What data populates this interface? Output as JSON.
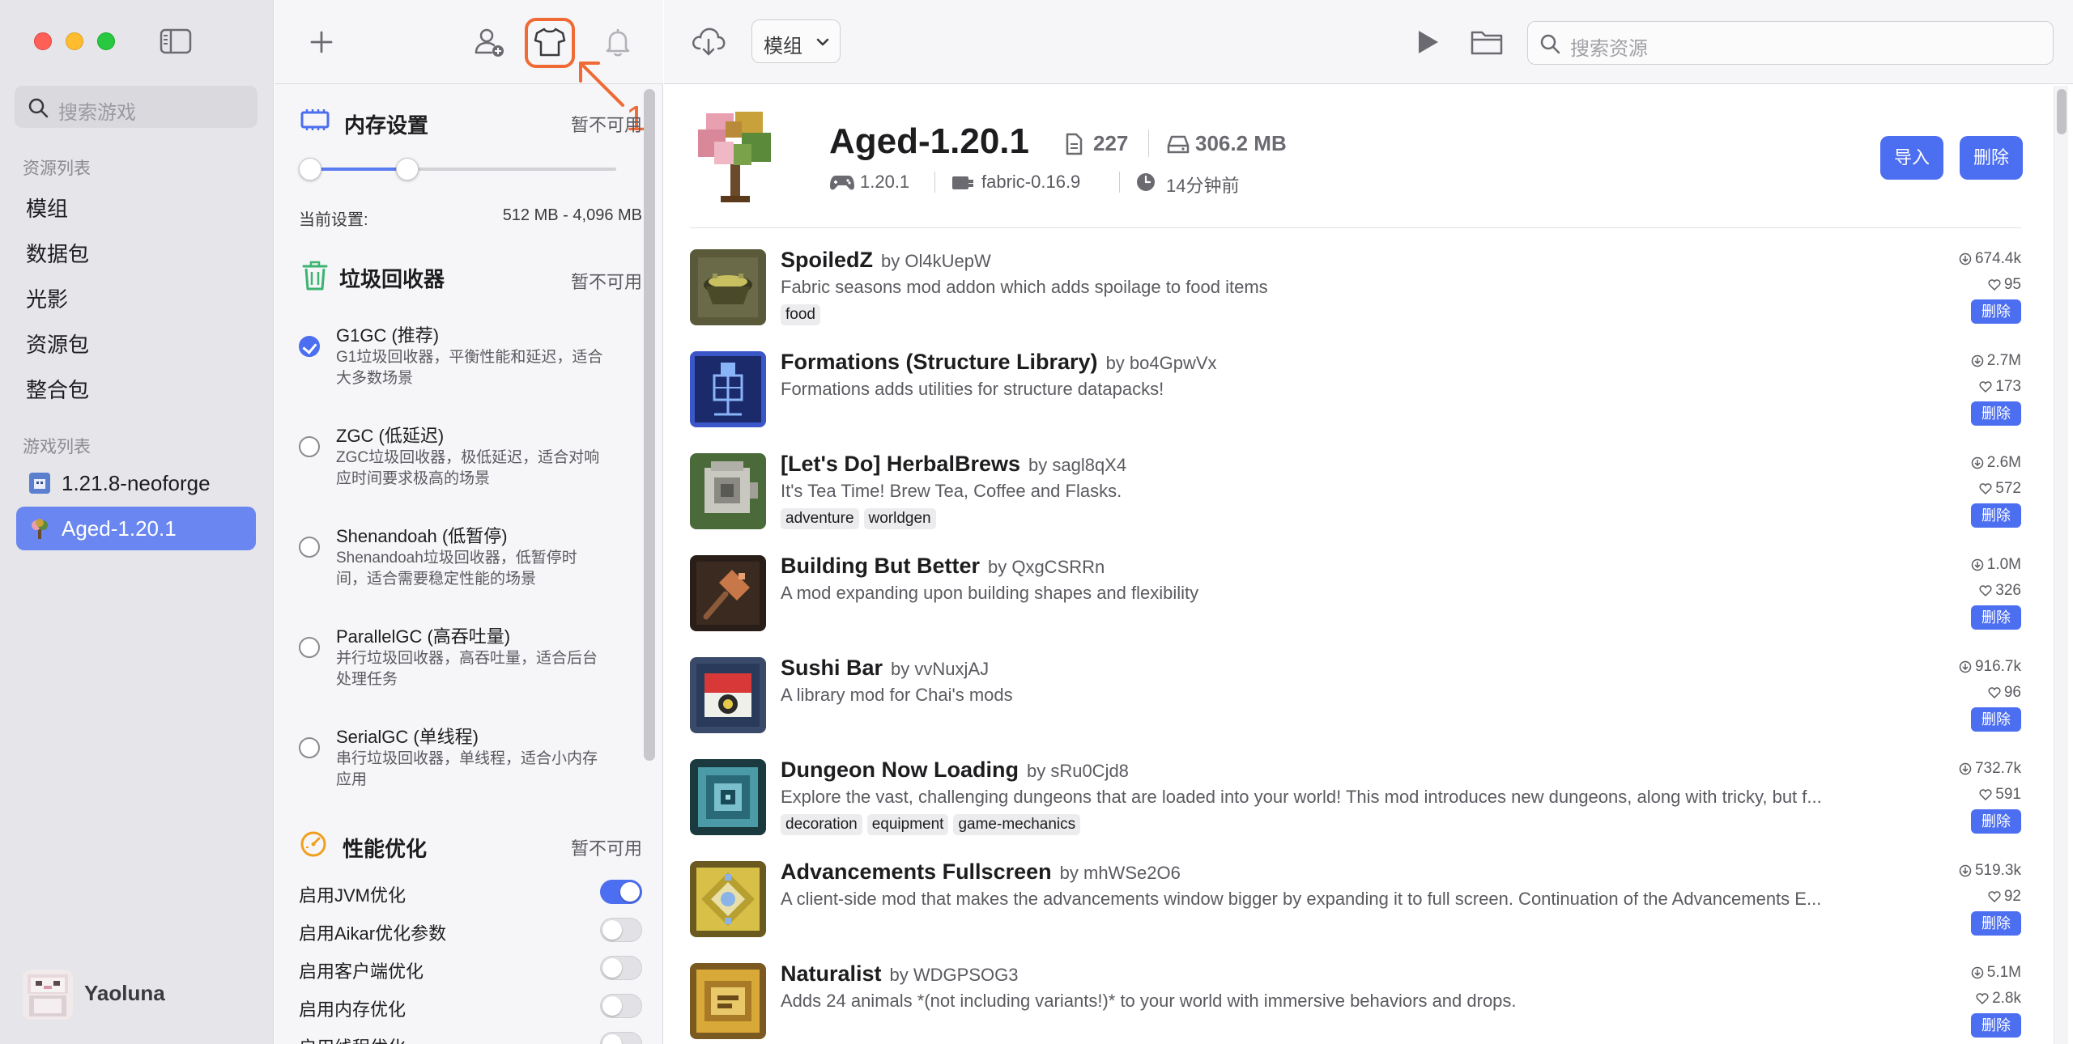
{
  "sidebar": {
    "search_placeholder": "搜索游戏",
    "resources_section": "资源列表",
    "resource_items": [
      "模组",
      "数据包",
      "光影",
      "资源包",
      "整合包"
    ],
    "games_section": "游戏列表",
    "games": [
      {
        "label": "1.21.8-neoforge",
        "active": false
      },
      {
        "label": "Aged-1.20.1",
        "active": true
      }
    ],
    "user_name": "Yaoluna"
  },
  "annotation": {
    "number": "1.",
    "color": "#ef6a35"
  },
  "settings": {
    "memory": {
      "title": "内存设置",
      "status": "暂不可用",
      "current_label": "当前设置:",
      "current_value": "512 MB - 4,096 MB"
    },
    "gc": {
      "title": "垃圾回收器",
      "status": "暂不可用",
      "options": [
        {
          "title": "G1GC (推荐)",
          "desc": "G1垃圾回收器，平衡性能和延迟，适合大多数场景",
          "selected": true
        },
        {
          "title": "ZGC (低延迟)",
          "desc": "ZGC垃圾回收器，极低延迟，适合对响应时间要求极高的场景",
          "selected": false
        },
        {
          "title": "Shenandoah (低暂停)",
          "desc": "Shenandoah垃圾回收器，低暂停时间，适合需要稳定性能的场景",
          "selected": false
        },
        {
          "title": "ParallelGC (高吞吐量)",
          "desc": "并行垃圾回收器，高吞吐量，适合后台处理任务",
          "selected": false
        },
        {
          "title": "SerialGC (单线程)",
          "desc": "串行垃圾回收器，单线程，适合小内存应用",
          "selected": false
        }
      ]
    },
    "perf": {
      "title": "性能优化",
      "status": "暂不可用",
      "options": [
        {
          "label": "启用JVM优化",
          "on": true
        },
        {
          "label": "启用Aikar优化参数",
          "on": false
        },
        {
          "label": "启用客户端优化",
          "on": false
        },
        {
          "label": "启用内存优化",
          "on": false
        },
        {
          "label": "启用线程优化",
          "on": false
        }
      ]
    }
  },
  "toolbar": {
    "type_select": "模组",
    "search_placeholder": "搜索资源"
  },
  "game": {
    "title": "Aged-1.20.1",
    "mod_count": "227",
    "size": "306.2 MB",
    "version": "1.20.1",
    "loader": "fabric-0.16.9",
    "updated": "14分钟前",
    "import_label": "导入",
    "delete_label": "删除"
  },
  "mods": [
    {
      "name": "SpoiledZ",
      "author": "by Ol4kUepW",
      "desc": "Fabric seasons mod addon which adds spoilage to food items",
      "tags": [
        "food"
      ],
      "downloads": "674.4k",
      "likes": "95",
      "delete": "删除"
    },
    {
      "name": "Formations (Structure Library)",
      "author": "by bo4GpwVx",
      "desc": "Formations adds utilities for structure datapacks!",
      "tags": [],
      "downloads": "2.7M",
      "likes": "173",
      "delete": "删除"
    },
    {
      "name": "[Let's Do] HerbalBrews",
      "author": "by sagl8qX4",
      "desc": "It's Tea Time! Brew Tea, Coffee and Flasks.",
      "tags": [
        "adventure",
        "worldgen"
      ],
      "downloads": "2.6M",
      "likes": "572",
      "delete": "删除"
    },
    {
      "name": "Building But Better",
      "author": "by QxgCSRRn",
      "desc": "A mod expanding upon building shapes and flexibility",
      "tags": [],
      "downloads": "1.0M",
      "likes": "326",
      "delete": "删除"
    },
    {
      "name": "Sushi Bar",
      "author": "by vvNuxjAJ",
      "desc": "A library mod for Chai's mods",
      "tags": [],
      "downloads": "916.7k",
      "likes": "96",
      "delete": "删除"
    },
    {
      "name": "Dungeon Now Loading",
      "author": "by sRu0Cjd8",
      "desc": "Explore the vast, challenging dungeons that are loaded into your world! This mod introduces new dungeons, along with tricky, but f...",
      "tags": [
        "decoration",
        "equipment",
        "game-mechanics"
      ],
      "downloads": "732.7k",
      "likes": "591",
      "delete": "删除"
    },
    {
      "name": "Advancements Fullscreen",
      "author": "by mhWSe2O6",
      "desc": "A client-side mod that makes the advancements window bigger by expanding it to full screen. Continuation of the Advancements E...",
      "tags": [],
      "downloads": "519.3k",
      "likes": "92",
      "delete": "删除"
    },
    {
      "name": "Naturalist",
      "author": "by WDGPSOG3",
      "desc": "Adds 24 animals *(not including variants!)* to your world with immersive behaviors and drops.",
      "tags": [],
      "downloads": "5.1M",
      "likes": "2.8k",
      "delete": "删除"
    }
  ]
}
